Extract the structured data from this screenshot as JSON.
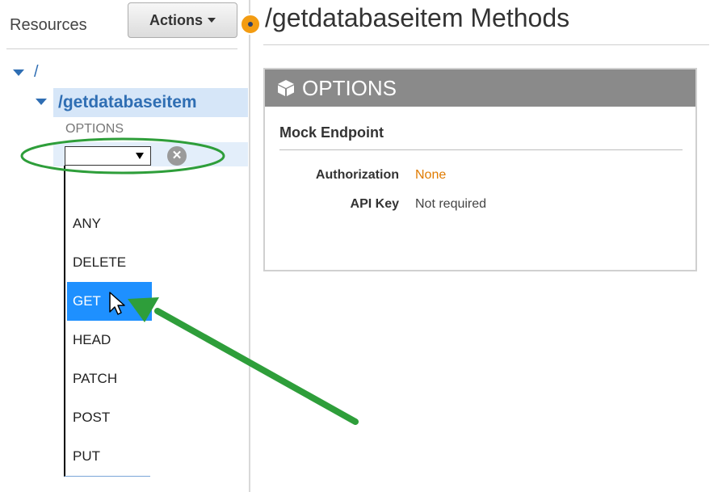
{
  "sidebar": {
    "title": "Resources",
    "actions_label": "Actions",
    "tree": {
      "root_path": "/",
      "resource_path": "/getdatabaseitem",
      "existing_method": "OPTIONS"
    },
    "new_method_select": {
      "selected_value": "",
      "options": [
        "ANY",
        "DELETE",
        "GET",
        "HEAD",
        "PATCH",
        "POST",
        "PUT"
      ],
      "highlighted_option": "GET"
    }
  },
  "main": {
    "title": "/getdatabaseitem Methods",
    "method_card": {
      "method": "OPTIONS",
      "integration_type": "Mock Endpoint",
      "fields": [
        {
          "label": "Authorization",
          "value": "None"
        },
        {
          "label": "API Key",
          "value": "Not required"
        }
      ]
    }
  },
  "colors": {
    "link_blue": "#2f6eb3",
    "highlight_blue": "#1e90ff",
    "status_orange": "#f39c12",
    "auth_value_orange": "#e07b00",
    "annotation_green": "#2e9e3a",
    "card_header_gray": "#8a8a8a"
  },
  "icons": [
    "chevron-down-icon",
    "cube-icon",
    "cancel-icon",
    "cursor-icon",
    "status-dot-icon"
  ]
}
